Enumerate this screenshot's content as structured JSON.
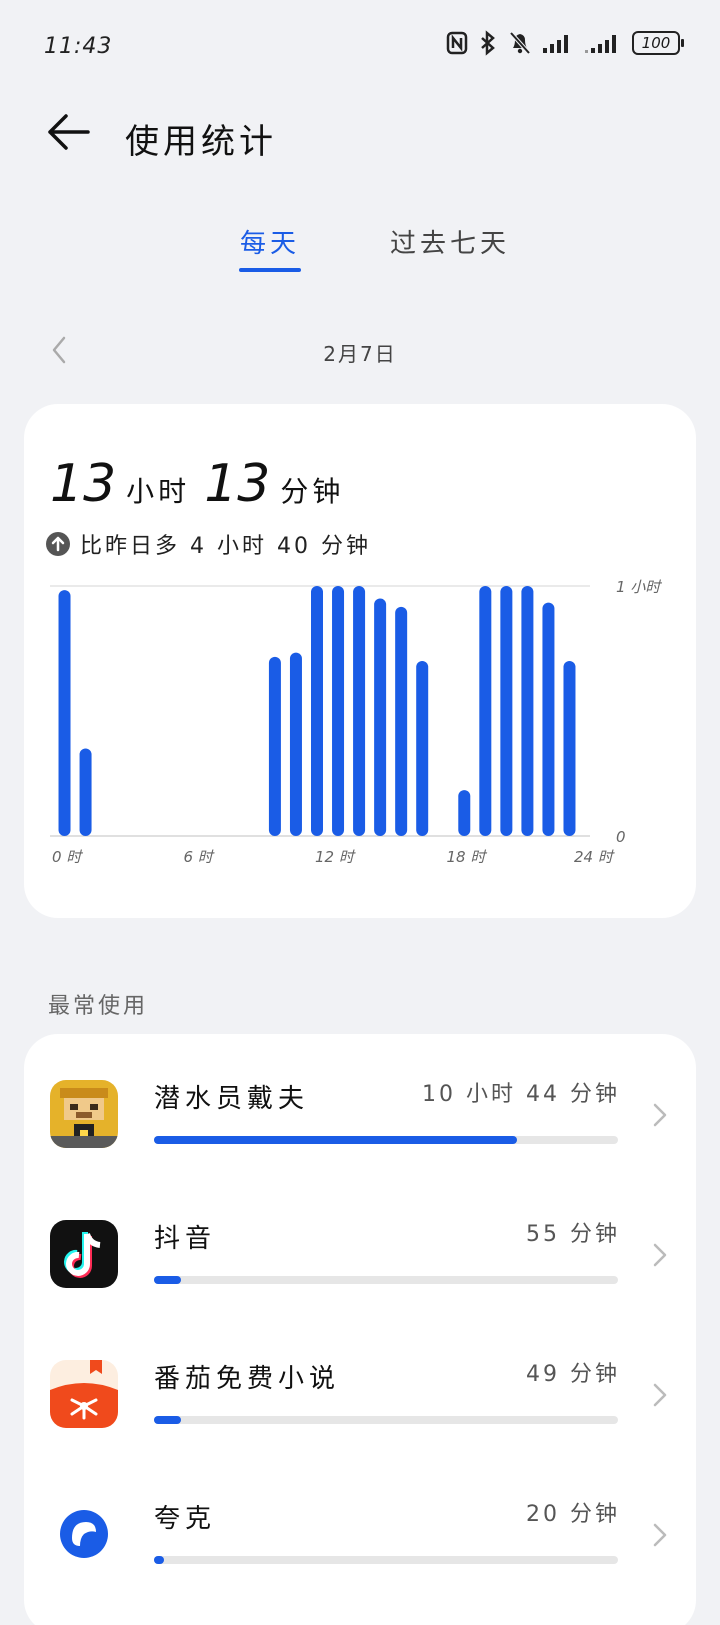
{
  "status_bar": {
    "time": "11:43",
    "battery": "100",
    "icons": [
      "nfc-icon",
      "bluetooth-icon",
      "mute-bell-icon",
      "signal-icon",
      "signal-icon-2"
    ]
  },
  "header": {
    "title": "使用统计",
    "back_icon": "arrow-left-icon"
  },
  "tabs": [
    {
      "label": "每天",
      "active": true
    },
    {
      "label": "过去七天",
      "active": false
    }
  ],
  "date": {
    "label": "2月7日"
  },
  "summary": {
    "hours": "13",
    "hours_unit": "小时",
    "minutes": "13",
    "minutes_unit": "分钟",
    "compare_text": "比昨日多 4 小时 40 分钟"
  },
  "chart_data": {
    "type": "bar",
    "x_tick_labels": [
      "0 时",
      "6 时",
      "12 时",
      "18 时",
      "24 时"
    ],
    "y_tick_labels": [
      "1 小时",
      "0"
    ],
    "y_unit": "minutes",
    "ylim": [
      0,
      60
    ],
    "hours": [
      0,
      1,
      2,
      3,
      4,
      5,
      6,
      7,
      8,
      9,
      10,
      11,
      12,
      13,
      14,
      15,
      16,
      17,
      18,
      19,
      20,
      21,
      22,
      23
    ],
    "values": [
      59,
      21,
      0,
      0,
      0,
      0,
      0,
      0,
      0,
      0,
      43,
      44,
      60,
      60,
      60,
      57,
      55,
      42,
      0,
      11,
      60,
      60,
      60,
      56,
      42
    ],
    "bar_color": "#1a5ce6",
    "grid": true
  },
  "most_used": {
    "title": "最常使用",
    "apps": [
      {
        "name": "潜水员戴夫",
        "time": "10 小时 44 分钟",
        "fraction": 0.81,
        "icon": "dave-diver-icon"
      },
      {
        "name": "抖音",
        "time": "55 分钟",
        "fraction": 0.06,
        "icon": "douyin-icon"
      },
      {
        "name": "番茄免费小说",
        "time": "49 分钟",
        "fraction": 0.06,
        "icon": "tomato-novel-icon"
      },
      {
        "name": "夸克",
        "time": "20 分钟",
        "fraction": 0.02,
        "icon": "quark-icon"
      }
    ]
  },
  "colors": {
    "accent": "#1a5ce6",
    "background": "#f1f2f5",
    "card": "#ffffff"
  }
}
